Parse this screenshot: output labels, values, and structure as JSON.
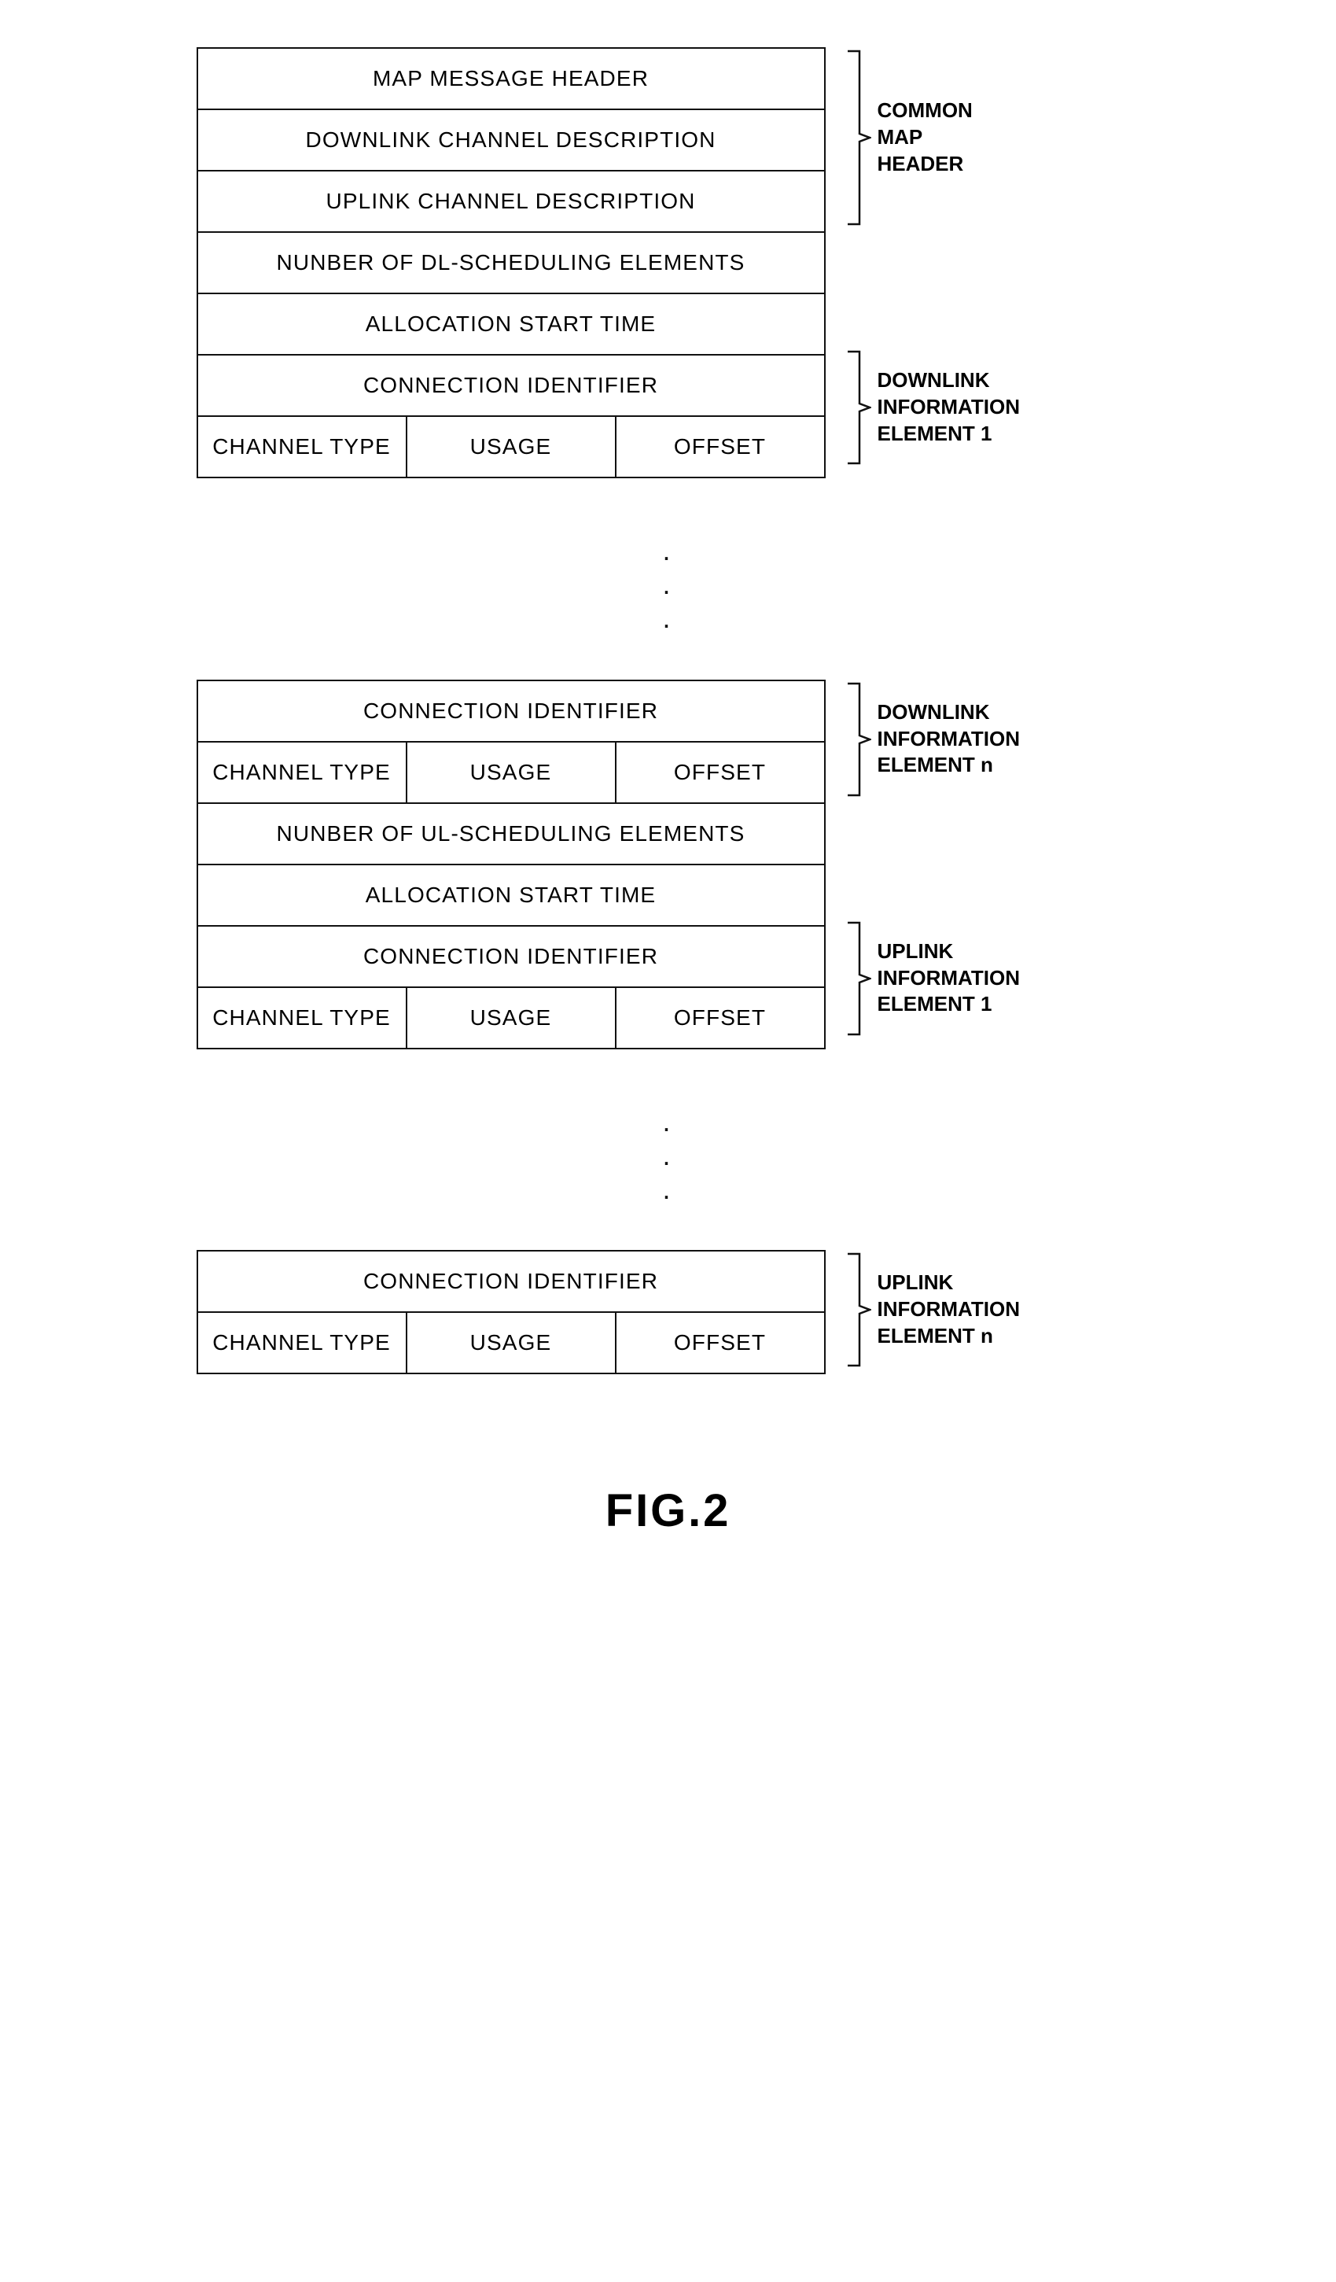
{
  "diagram": {
    "block1": {
      "rows": [
        {
          "type": "full",
          "label": "MAP MESSAGE HEADER"
        },
        {
          "type": "full",
          "label": "DOWNLINK CHANNEL DESCRIPTION"
        },
        {
          "type": "full",
          "label": "UPLINK CHANNEL DESCRIPTION"
        },
        {
          "type": "full",
          "label": "NUNBER OF DL-SCHEDULING ELEMENTS"
        },
        {
          "type": "full",
          "label": "ALLOCATION START TIME"
        },
        {
          "type": "full",
          "label": "CONNECTION IDENTIFIER"
        },
        {
          "type": "split",
          "cells": [
            "CHANNEL TYPE",
            "USAGE",
            "OFFSET"
          ]
        }
      ],
      "annotations": [
        {
          "label": "COMMON\nMAP\nHEADER",
          "rows_start": 0,
          "rows_end": 2
        },
        {
          "label": "DOWNLINK\nINFORMATION\nELEMENT 1",
          "rows_start": 4,
          "rows_end": 6
        }
      ]
    },
    "block2": {
      "rows": [
        {
          "type": "full",
          "label": "CONNECTION IDENTIFIER"
        },
        {
          "type": "split",
          "cells": [
            "CHANNEL TYPE",
            "USAGE",
            "OFFSET"
          ]
        },
        {
          "type": "full",
          "label": "NUNBER OF UL-SCHEDULING ELEMENTS"
        },
        {
          "type": "full",
          "label": "ALLOCATION START TIME"
        },
        {
          "type": "full",
          "label": "CONNECTION IDENTIFIER"
        },
        {
          "type": "split",
          "cells": [
            "CHANNEL TYPE",
            "USAGE",
            "OFFSET"
          ]
        }
      ],
      "annotations": [
        {
          "label": "DOWNLINK\nINFORMATION\nELEMENT n",
          "rows_start": 0,
          "rows_end": 1
        },
        {
          "label": "UPLINK\nINFORMATION\nELEMENT 1",
          "rows_start": 3,
          "rows_end": 5
        }
      ]
    },
    "block3": {
      "rows": [
        {
          "type": "full",
          "label": "CONNECTION IDENTIFIER"
        },
        {
          "type": "split",
          "cells": [
            "CHANNEL TYPE",
            "USAGE",
            "OFFSET"
          ]
        }
      ],
      "annotations": [
        {
          "label": "UPLINK\nINFORMATION\nELEMENT n",
          "rows_start": 0,
          "rows_end": 1
        }
      ]
    }
  },
  "figure_label": "FIG.2"
}
